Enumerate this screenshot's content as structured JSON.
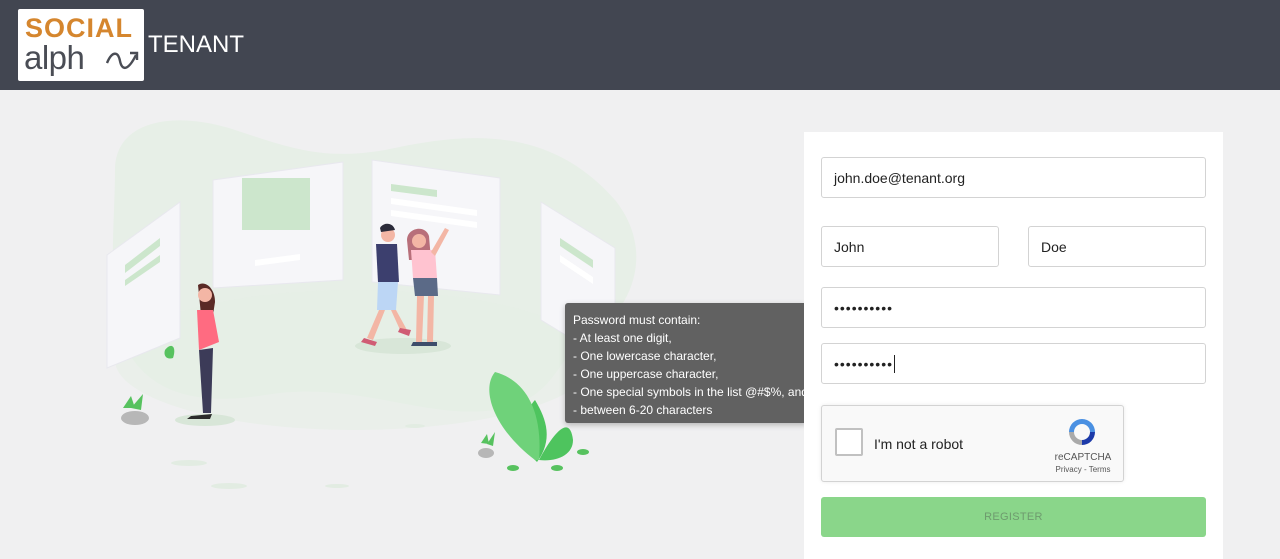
{
  "header": {
    "logo": {
      "line1": "SOCIAL",
      "line2": "alph"
    },
    "title": "TENANT"
  },
  "tooltip": {
    "lines": [
      "Password must contain:",
      "- At least one digit,",
      "- One lowercase character,",
      "- One uppercase character,",
      "- One special symbols in the list @#$%, and",
      "- between 6-20 characters"
    ]
  },
  "form": {
    "email": "john.doe@tenant.org",
    "first_name": "John",
    "last_name": "Doe",
    "password": "••••••••••",
    "confirm_password": "••••••••••",
    "captcha": {
      "label": "I'm not a robot",
      "brand": "reCAPTCHA",
      "links": "Privacy - Terms"
    },
    "register_label": "REGISTER"
  },
  "colors": {
    "header_bg": "#424651",
    "logo_orange": "#d5862e",
    "register_bg": "#8ad68a",
    "tooltip_bg": "#616161"
  }
}
